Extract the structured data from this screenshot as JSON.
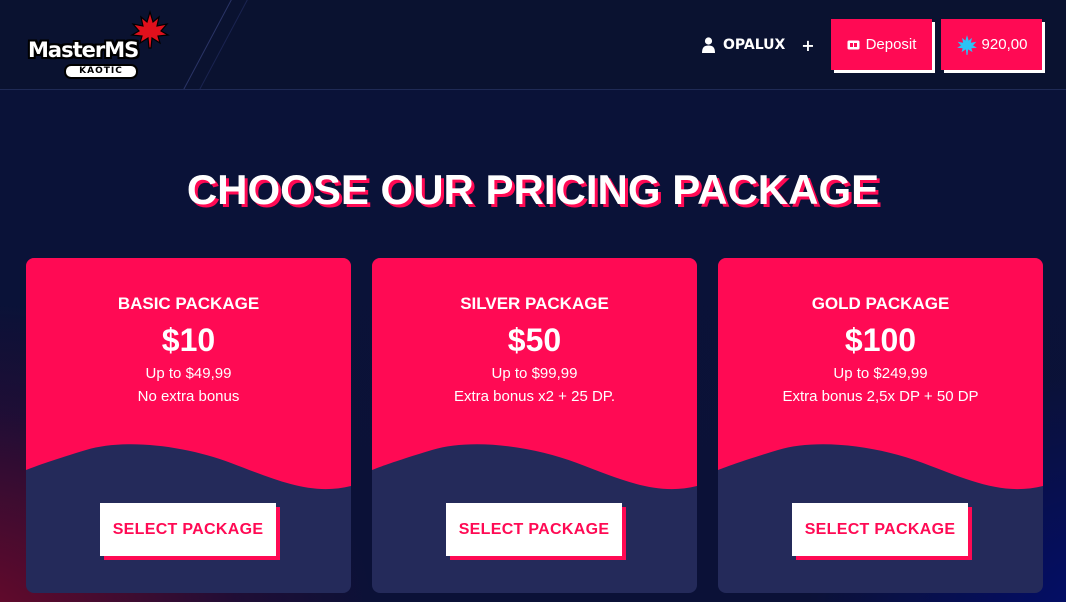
{
  "logo": {
    "main": "MasterMS",
    "sub": "KAOTIC"
  },
  "header": {
    "username": "OPALUX",
    "plus": "+",
    "deposit_label": "Deposit",
    "balance": "920,00"
  },
  "title": "CHOOSE OUR PRICING PACKAGE",
  "packages": [
    {
      "name": "BASIC PACKAGE",
      "price": "$10",
      "range": "Up to $49,99",
      "bonus": "No extra bonus",
      "button": "SELECT PACKAGE"
    },
    {
      "name": "SILVER PACKAGE",
      "price": "$50",
      "range": "Up to $99,99",
      "bonus": "Extra bonus x2 + 25 DP.",
      "button": "SELECT PACKAGE"
    },
    {
      "name": "GOLD PACKAGE",
      "price": "$100",
      "range": "Up to $249,99",
      "bonus": "Extra bonus 2,5x DP + 50 DP",
      "button": "SELECT PACKAGE"
    }
  ],
  "colors": {
    "accent": "#ff0a54",
    "background": "#0b1137",
    "card_bottom": "#242a5a"
  },
  "icons": {
    "user": "user-icon",
    "deposit": "ticket-icon",
    "balance": "maple-leaf-icon",
    "logo": "maple-leaf-icon"
  }
}
